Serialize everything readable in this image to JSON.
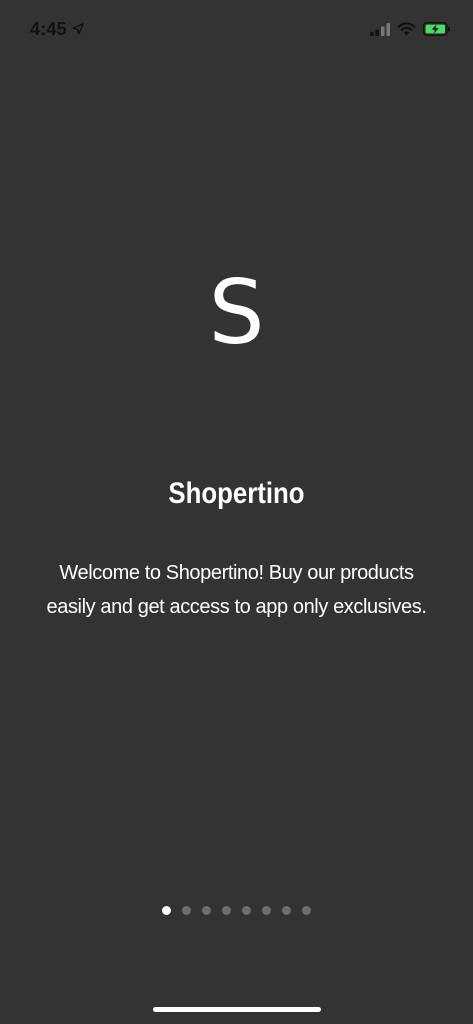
{
  "status_bar": {
    "time": "4:45",
    "icons": [
      "location-arrow-icon",
      "cellular-signal-icon",
      "wifi-icon",
      "battery-charging-icon"
    ],
    "battery_color": "#4cd964"
  },
  "onboarding": {
    "logo_letter": "S",
    "title": "Shopertino",
    "description": "Welcome to Shopertino! Buy our products easily and get access to app only exclusives.",
    "page_count": 8,
    "current_page": 1
  },
  "colors": {
    "background": "#333333",
    "text": "#ffffff",
    "dot_inactive": "#6e6e6e",
    "dot_active": "#ffffff"
  }
}
